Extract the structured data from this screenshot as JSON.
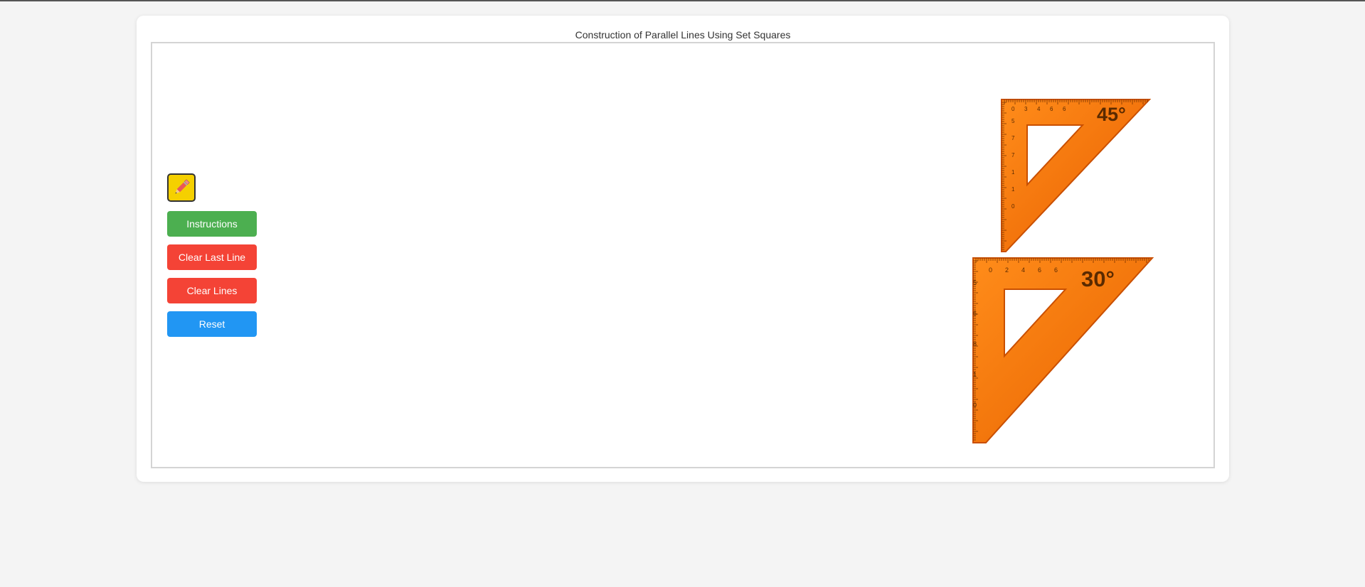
{
  "app": {
    "title": "Construction of Parallel Lines Using Set Squares"
  },
  "toolbar": {
    "pencil_icon": "pencil-icon",
    "instructions_label": "Instructions",
    "clear_last_label": "Clear Last Line",
    "clear_lines_label": "Clear Lines",
    "reset_label": "Reset"
  },
  "setsquares": {
    "sq45": {
      "angle_label": "45°",
      "top_scale": [
        "0",
        "3",
        "4",
        "6",
        "6"
      ],
      "side_scale": [
        "5",
        "7",
        "7",
        "1",
        "1",
        "0"
      ]
    },
    "sq30": {
      "angle_label": "30°",
      "top_scale": [
        "0",
        "2",
        "4",
        "6",
        "6"
      ],
      "side_scale": [
        "5",
        "6",
        "8",
        "1",
        "0"
      ]
    }
  },
  "colors": {
    "instructions": "#4caf50",
    "clear": "#f44336",
    "reset": "#2196f3",
    "pencil_button": "#f5d000",
    "setsquare": "#ff7a00"
  }
}
